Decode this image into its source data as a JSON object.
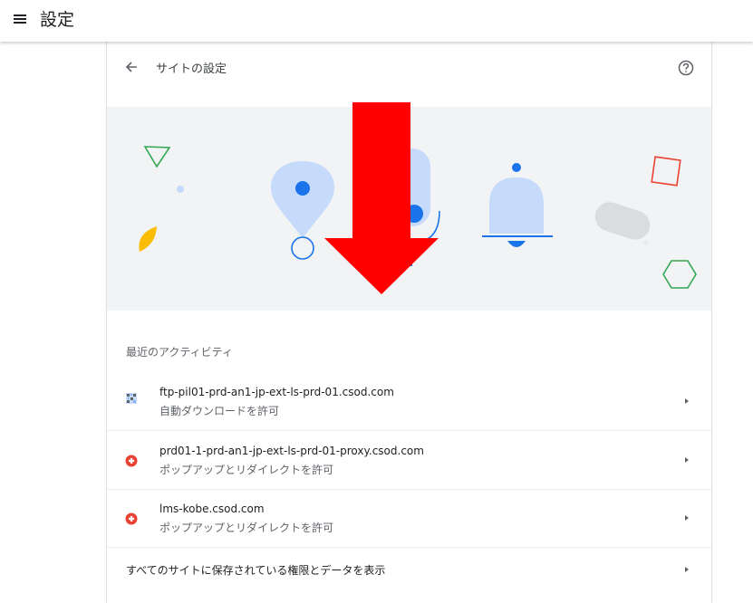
{
  "topbar": {
    "menu_icon": "hamburger-menu-icon",
    "title": "設定"
  },
  "card": {
    "back_icon": "back-arrow-icon",
    "title": "サイトの設定",
    "help_icon": "help-circle-icon"
  },
  "banner": {
    "illustration": "site-permissions-illustration",
    "colors": {
      "background": "#f1f3f4",
      "light_blue": "#c6dafc",
      "blue": "#1a73e8",
      "green": "#34a853",
      "yellow": "#fbbc04",
      "red": "#ea4335",
      "grey": "#dadce0"
    }
  },
  "overlay": {
    "icon": "red-down-arrow-icon",
    "color": "#ff0000"
  },
  "recent_activity": {
    "title": "最近のアクティビティ",
    "items": [
      {
        "icon": "site-favicon-icon",
        "site": "ftp-pil01-prd-an1-jp-ext-ls-prd-01.csod.com",
        "permission": "自動ダウンロードを許可"
      },
      {
        "icon": "csod-red-logo-icon",
        "site": "prd01-1-prd-an1-jp-ext-ls-prd-01-proxy.csod.com",
        "permission": "ポップアップとリダイレクトを許可"
      },
      {
        "icon": "csod-red-logo-icon",
        "site": "lms-kobe.csod.com",
        "permission": "ポップアップとリダイレクトを許可"
      }
    ]
  },
  "all_sites_link": "すべてのサイトに保存されている権限とデータを表示",
  "chevron_icon": "chevron-right-icon"
}
